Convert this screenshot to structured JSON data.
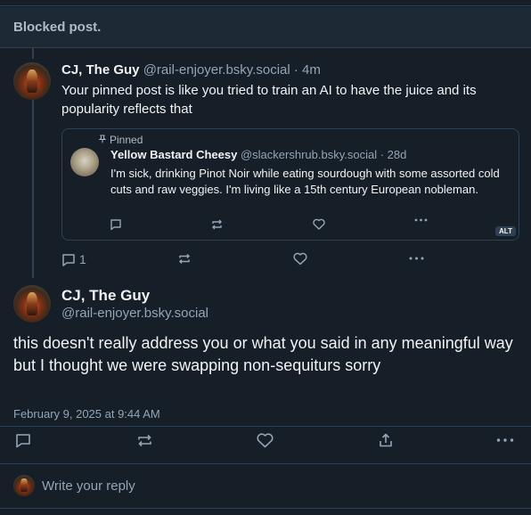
{
  "blocked": {
    "label": "Blocked post."
  },
  "reply": {
    "author_name": "CJ, The Guy",
    "author_handle": "@rail-enjoyer.bsky.social",
    "time": "· 4m",
    "text": "Your pinned post is like you tried to train an AI to have the juice and its popularity reflects that",
    "reply_count": "1"
  },
  "quote": {
    "pinned_label": "Pinned",
    "author_name": "Yellow Bastard Cheesy",
    "author_handle": "@slackershrub.bsky.social",
    "time": "· 28d",
    "text": "I'm sick, drinking Pinot Noir while eating sourdough with some assorted cold cuts and raw veggies. I'm living like a 15th century European nobleman.",
    "alt_badge": "ALT"
  },
  "main": {
    "author_name": "CJ, The Guy",
    "author_handle": "@rail-enjoyer.bsky.social",
    "text": "this doesn't really address you or what you said in any meaningful way but I thought we were swapping non-sequiturs sorry",
    "timestamp": "February 9, 2025 at 9:44 AM"
  },
  "compose": {
    "placeholder": "Write your reply"
  },
  "colors": {
    "background": "#161e27",
    "border": "#2e4052",
    "muted": "#93a5b7",
    "text": "#f1f3f5"
  }
}
